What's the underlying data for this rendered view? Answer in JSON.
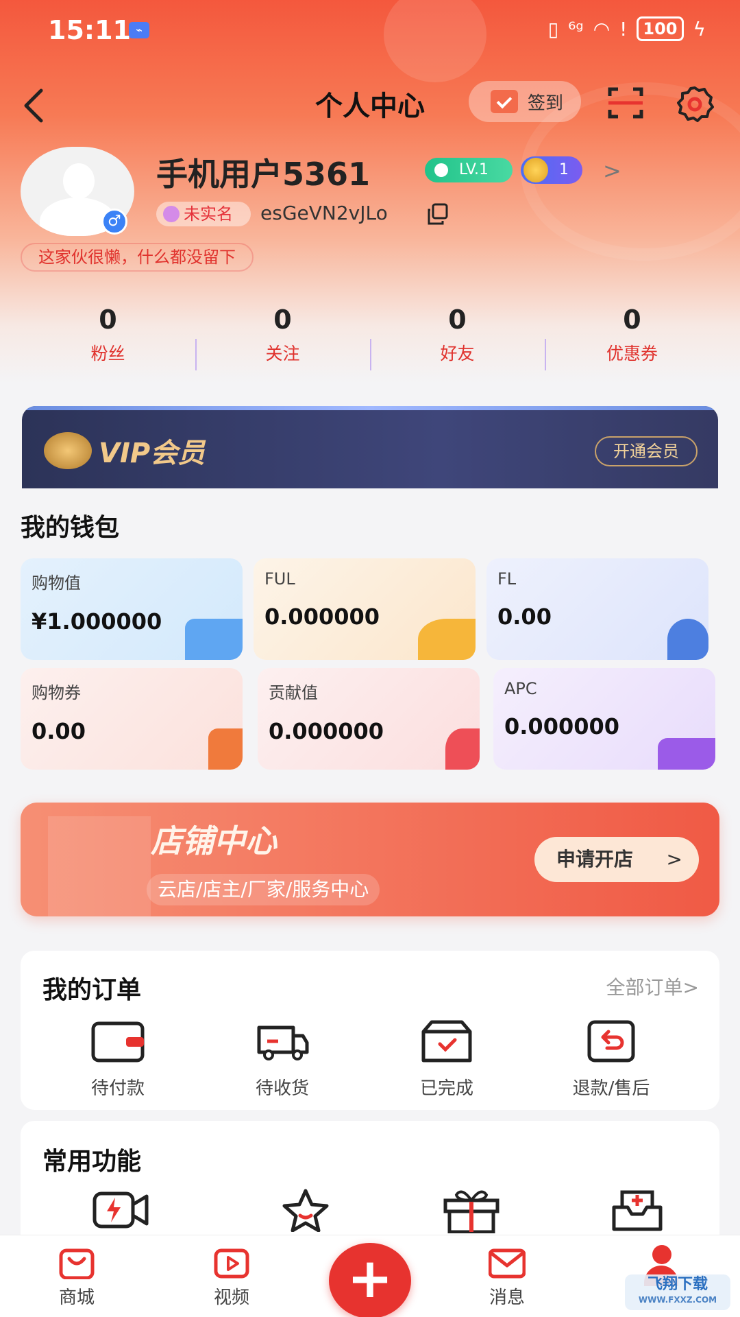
{
  "status_bar": {
    "time": "15:11",
    "network": "⁶",
    "battery": "100"
  },
  "header": {
    "title": "个人中心",
    "signin_label": "签到"
  },
  "profile": {
    "username": "手机用户5361",
    "level": "LV.1",
    "medal_count": "1",
    "realname_status": "未实名",
    "user_code": "esGeVN2vJLo",
    "bio": "这家伙很懒，什么都没留下",
    "gender_symbol": "♂"
  },
  "stats": [
    {
      "value": "0",
      "label": "粉丝"
    },
    {
      "value": "0",
      "label": "关注"
    },
    {
      "value": "0",
      "label": "好友"
    },
    {
      "value": "0",
      "label": "优惠券"
    }
  ],
  "vip": {
    "title": "VIP会员",
    "button": "开通会员"
  },
  "wallet": {
    "title": "我的钱包",
    "items": [
      {
        "label": "购物值",
        "value": "¥1.000000",
        "color": "#e4f1fd"
      },
      {
        "label": "FUL",
        "value": "0.000000",
        "color": "#fdf0e2"
      },
      {
        "label": "FL",
        "value": "0.00",
        "color": "#e9eefd"
      },
      {
        "label": "购物券",
        "value": "0.00",
        "color": "#fdeae8"
      },
      {
        "label": "贡献值",
        "value": "0.000000",
        "color": "#fdeaea"
      },
      {
        "label": "APC",
        "value": "0.000000",
        "color": "#f3ecfd"
      }
    ]
  },
  "shop": {
    "title": "店铺中心",
    "subtitle": "云店/店主/厂家/服务中心",
    "button": "申请开店"
  },
  "orders": {
    "title": "我的订单",
    "all_link": "全部订单>",
    "items": [
      {
        "label": "待付款",
        "icon": "wallet-icon"
      },
      {
        "label": "待收货",
        "icon": "truck-icon"
      },
      {
        "label": "已完成",
        "icon": "box-check-icon"
      },
      {
        "label": "退款/售后",
        "icon": "refund-icon"
      }
    ]
  },
  "functions": {
    "title": "常用功能",
    "icons": [
      "video-flash-icon",
      "star-icon",
      "gift-icon",
      "inbox-add-icon"
    ]
  },
  "tabbar": {
    "items": [
      {
        "label": "商城",
        "icon": "shop-bag-icon"
      },
      {
        "label": "视频",
        "icon": "video-play-icon"
      },
      {
        "label": "消息",
        "icon": "mail-icon"
      }
    ],
    "fab_symbol": "+"
  },
  "watermark": {
    "text": "飞翔下载",
    "url_text": "WWW.FXXZ.COM"
  },
  "colors": {
    "brand_red": "#e7332f",
    "stat_label": "#e0322d",
    "vip_bg": "#2c3358",
    "vip_gold": "#f2c98a"
  }
}
